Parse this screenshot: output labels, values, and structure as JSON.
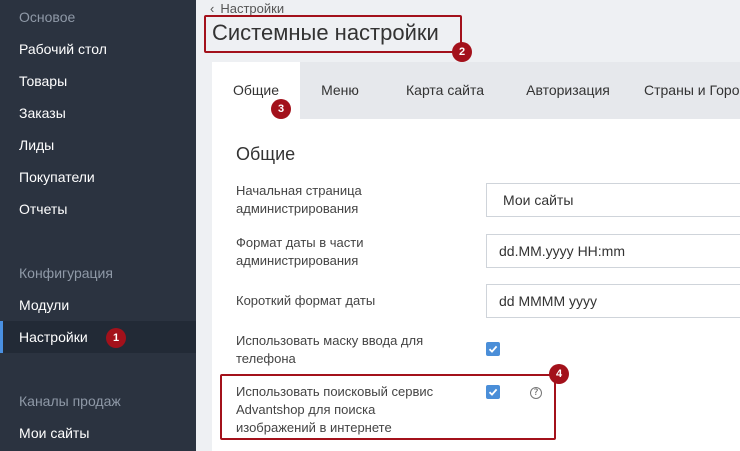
{
  "sidebar": {
    "sections": [
      {
        "title": "Основое",
        "items": [
          "Рабочий стол",
          "Товары",
          "Заказы",
          "Лиды",
          "Покупатели",
          "Отчеты"
        ]
      },
      {
        "title": "Конфигурация",
        "items": [
          "Модули",
          "Настройки"
        ]
      },
      {
        "title": "Каналы продаж",
        "items": [
          "Мои сайты"
        ]
      }
    ],
    "active_item": "Настройки"
  },
  "breadcrumb": {
    "label": "Настройки"
  },
  "page_title": "Системные настройки",
  "tabs": [
    "Общие",
    "Меню",
    "Карта сайта",
    "Авторизация",
    "Страны и Горо"
  ],
  "section_title": "Общие",
  "settings": {
    "start_page": {
      "label": "Начальная страница администрирования",
      "value": "Мои сайты"
    },
    "date_format": {
      "label": "Формат даты в части администрирования",
      "value": "dd.MM.yyyy HH:mm"
    },
    "short_date_format": {
      "label": "Короткий формат даты",
      "value": "dd MMMM yyyy"
    },
    "phone_mask": {
      "label": "Использовать маску ввода для телефона",
      "checked": true
    },
    "image_search": {
      "label": "Использовать поисковый сервис Advantshop для поиска изображений в интернете",
      "checked": true
    }
  },
  "annotations": [
    "1",
    "2",
    "3",
    "4"
  ],
  "colors": {
    "sidebar_bg": "#2b3340",
    "accent": "#4a8ed8",
    "annotation": "#a3111b"
  }
}
